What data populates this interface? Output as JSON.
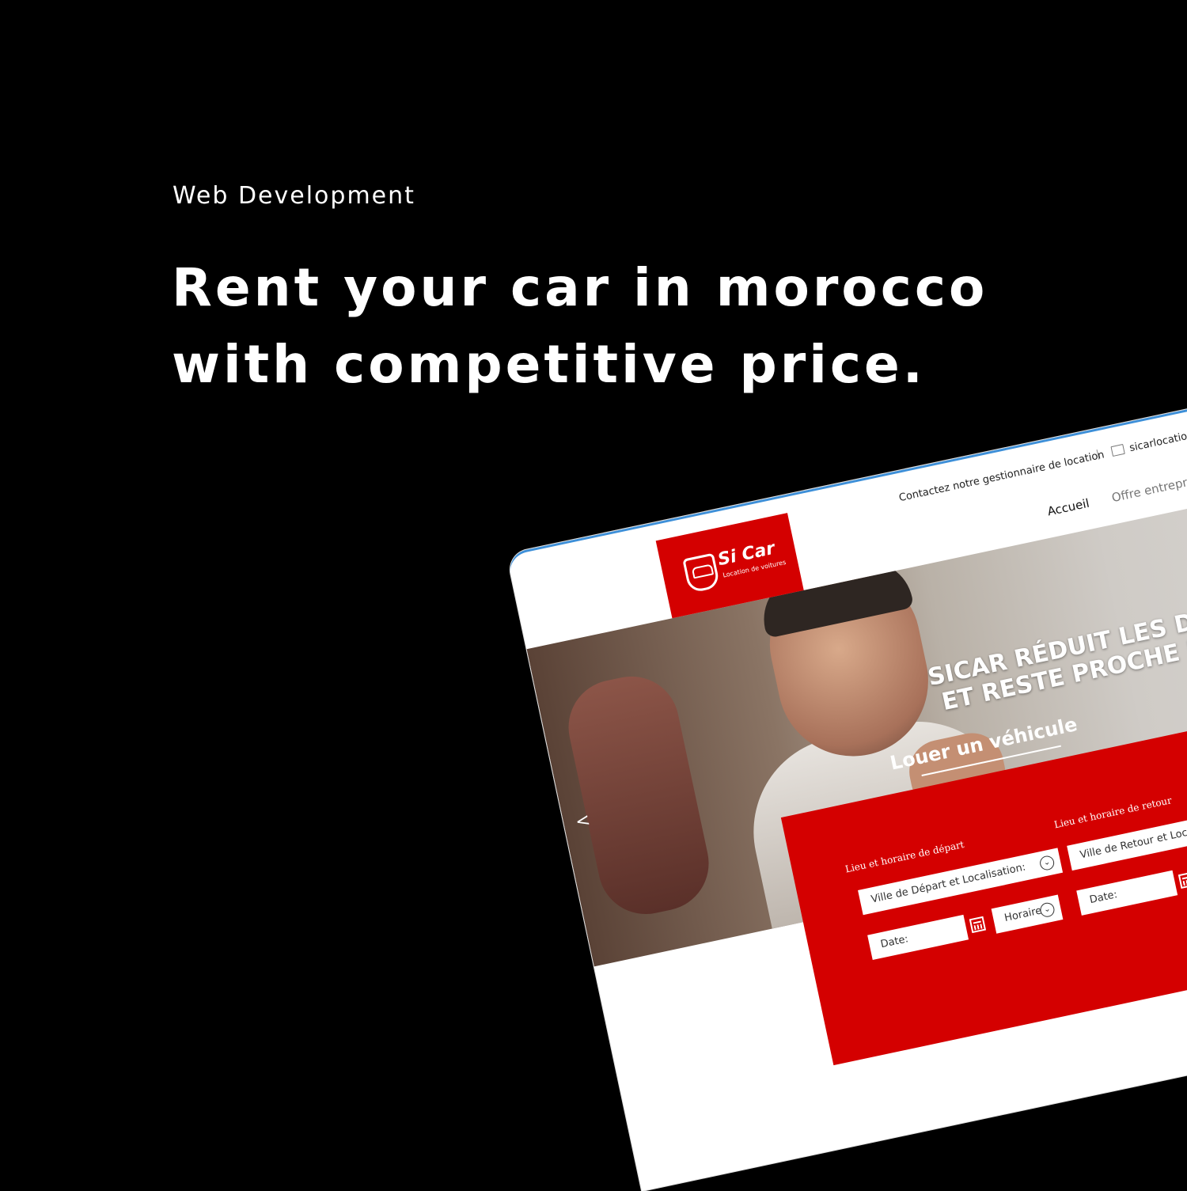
{
  "eyebrow": "Web Development",
  "headline": {
    "line1": "Rent your car in morocco",
    "line2": "with competitive price."
  },
  "site": {
    "topbar": {
      "contact": "Contactez notre gestionnaire de location",
      "separator": "|",
      "email_partial": "sicarlocatio"
    },
    "nav": {
      "home": "Accueil",
      "business": "Offre entreprise"
    },
    "logo": {
      "name": "Si Car",
      "tagline": "Location de voitures",
      "brand_color": "#d40000"
    },
    "hero": {
      "slogan_line1": "SICAR RÉDUIT LES DISTAN",
      "slogan_line2": "ET RESTE PROCHE DE VO",
      "prev_arrow": "<"
    },
    "booking": {
      "title": "Louer un véhicule",
      "departure_heading": "Lieu et horaire de départ",
      "return_heading": "Lieu et horaire de retour",
      "departure_city_placeholder": "Ville de Départ et Localisation:",
      "return_city_placeholder": "Ville de Retour et Localisation:",
      "date_label": "Date:",
      "time_label": "Horaire"
    }
  }
}
